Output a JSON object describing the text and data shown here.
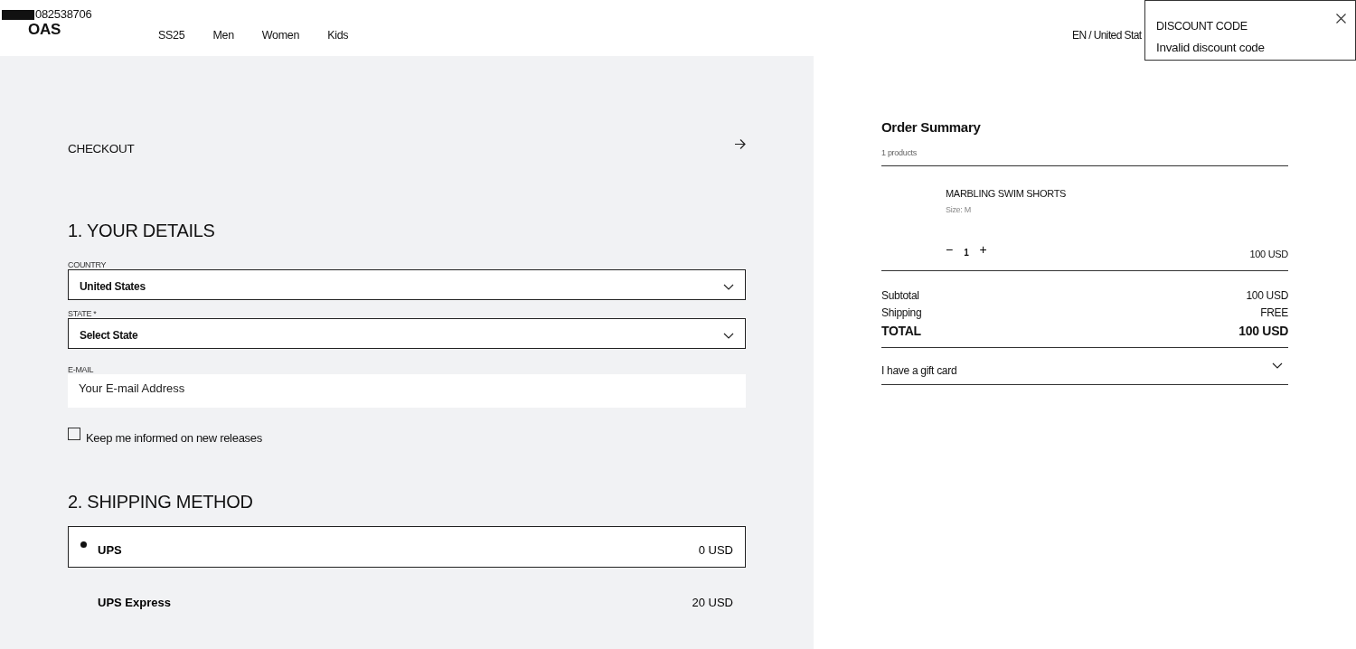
{
  "header": {
    "phone": "082538706",
    "logo": "OAS",
    "nav": [
      {
        "label": "SS25"
      },
      {
        "label": "Men"
      },
      {
        "label": "Women"
      },
      {
        "label": "Kids"
      }
    ],
    "locale": "EN / United Stat"
  },
  "toast": {
    "title": "DISCOUNT CODE",
    "message": "Invalid discount code"
  },
  "checkout": {
    "title": "CHECKOUT",
    "details": {
      "heading": "1. YOUR DETAILS",
      "fields": [
        {
          "kind": "select",
          "label": "COUNTRY",
          "value": "United States"
        },
        {
          "kind": "select",
          "label": "STATE *",
          "value": "Select State"
        },
        {
          "kind": "input",
          "label": "E-MAIL",
          "placeholder": "Your E-mail Address"
        }
      ],
      "newsletter": {
        "label": "Keep me informed on new releases",
        "checked": false
      }
    },
    "shipping": {
      "heading": "2. SHIPPING METHOD",
      "options": [
        {
          "name": "UPS",
          "price": "0 USD",
          "selected": true
        },
        {
          "name": "UPS Express",
          "price": "20 USD",
          "selected": false
        }
      ]
    }
  },
  "summary": {
    "title": "Order Summary",
    "count": "1 products",
    "items": [
      {
        "name": "MARBLING SWIM SHORTS",
        "size": "Size: M",
        "decrease": "−",
        "quantity": "1",
        "increase": "+",
        "price": "100 USD"
      }
    ],
    "totals": [
      {
        "kind": "normal",
        "label": "Subtotal",
        "value": "100 USD"
      },
      {
        "kind": "normal",
        "label": "Shipping",
        "value": "FREE"
      },
      {
        "kind": "total",
        "label": "TOTAL",
        "value": "100 USD"
      }
    ],
    "gift_card": "I have a gift card"
  }
}
